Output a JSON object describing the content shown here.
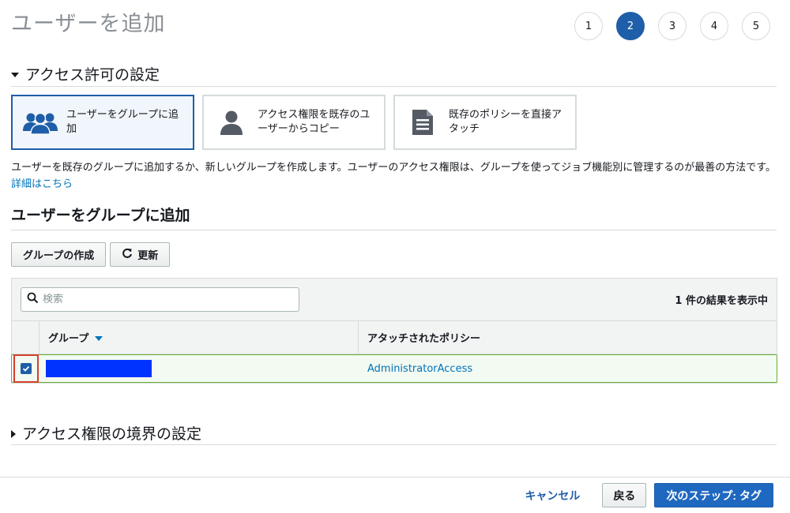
{
  "page": {
    "title": "ユーザーを追加"
  },
  "steps": [
    {
      "label": "1",
      "active": false
    },
    {
      "label": "2",
      "active": true
    },
    {
      "label": "3",
      "active": false
    },
    {
      "label": "4",
      "active": false
    },
    {
      "label": "5",
      "active": false
    }
  ],
  "permissions": {
    "heading": "アクセス許可の設定",
    "options": [
      {
        "label": "ユーザーをグループに追加",
        "icon": "users-group-icon",
        "selected": true
      },
      {
        "label": "アクセス権限を既存のユーザーからコピー",
        "icon": "user-icon",
        "selected": false
      },
      {
        "label": "既存のポリシーを直接アタッチ",
        "icon": "document-icon",
        "selected": false
      }
    ],
    "description": "ユーザーを既存のグループに追加するか、新しいグループを作成します。ユーザーのアクセス権限は、グループを使ってジョブ機能別に管理するのが最善の方法です。",
    "details_link": "詳細はこちら"
  },
  "groups": {
    "heading": "ユーザーをグループに追加",
    "create_button": "グループの作成",
    "refresh_button": "更新",
    "search_placeholder": "検索",
    "result_count": "1 件の結果を表示中",
    "columns": {
      "group": "グループ",
      "policy": "アタッチされたポリシー"
    },
    "rows": [
      {
        "checked": true,
        "group_name_redacted": true,
        "policy": "AdministratorAccess"
      }
    ]
  },
  "boundary": {
    "heading": "アクセス権限の境界の設定"
  },
  "footer": {
    "cancel": "キャンセル",
    "back": "戻る",
    "next": "次のステップ: タグ"
  },
  "colors": {
    "primary": "#1f5ea8",
    "link": "#0073bb",
    "border": "#d5dbdb",
    "selected_row_border": "#6aaf35",
    "highlight": "#d6402a",
    "redaction": "#0033ff"
  }
}
